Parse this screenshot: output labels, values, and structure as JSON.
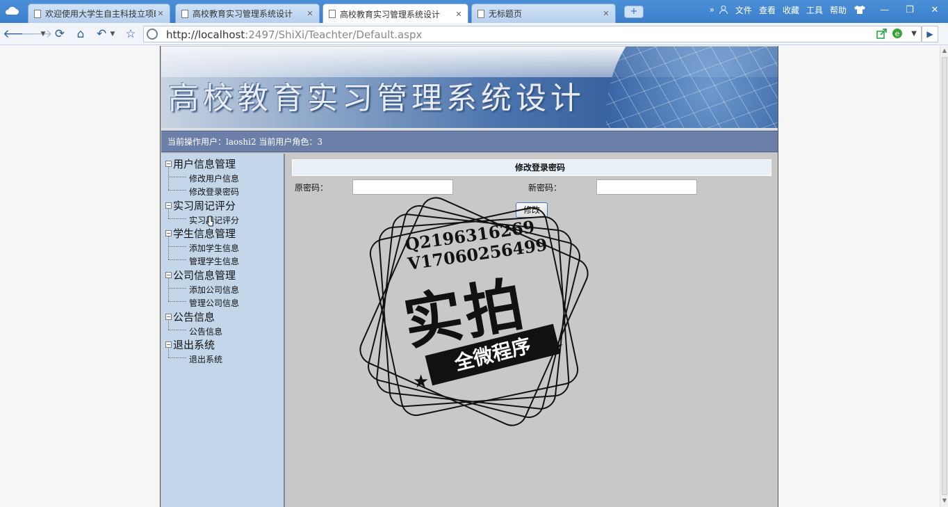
{
  "browser": {
    "tabs": [
      {
        "label": "欢迎使用大学生自主科技立项Ex",
        "active": false
      },
      {
        "label": "高校教育实习管理系统设计",
        "active": false
      },
      {
        "label": "高校教育实习管理系统设计",
        "active": true
      },
      {
        "label": "无标题页",
        "active": false
      }
    ],
    "new_tab": "+",
    "menus": [
      "文件",
      "查看",
      "收藏",
      "工具",
      "帮助"
    ],
    "url_scheme_host": "http://localhost",
    "url_rest": ":2497/ShiXi/Teachter/Default.aspx"
  },
  "site": {
    "banner_title": "高校教育实习管理系统设计",
    "user_info": "当前操作用户：laoshi2 当前用户角色：3"
  },
  "sidebar": {
    "groups": [
      {
        "label": "用户信息管理",
        "items": [
          "修改用户信息",
          "修改登录密码"
        ]
      },
      {
        "label": "实习周记评分",
        "items": [
          "实习周记评分"
        ]
      },
      {
        "label": "学生信息管理",
        "items": [
          "添加学生信息",
          "管理学生信息"
        ]
      },
      {
        "label": "公司信息管理",
        "items": [
          "添加公司信息",
          "管理公司信息"
        ]
      },
      {
        "label": "公告信息",
        "items": [
          "公告信息"
        ]
      },
      {
        "label": "退出系统",
        "items": [
          "退出系统"
        ]
      }
    ],
    "expander": "−"
  },
  "form": {
    "title": "修改登录密码",
    "old_label": "原密码：",
    "new_label": "新密码：",
    "old_value": "",
    "new_value": "",
    "submit": "修改"
  },
  "watermark": {
    "line1": "Q2196316269",
    "line2": "V17060256499",
    "big": "实拍",
    "ribbon": "全微程序"
  },
  "colors": {
    "tabbar": "#3b7fcb",
    "userbar": "#6b7fa8",
    "sidebar": "#c4d6ea",
    "content": "#c8c8c8"
  }
}
